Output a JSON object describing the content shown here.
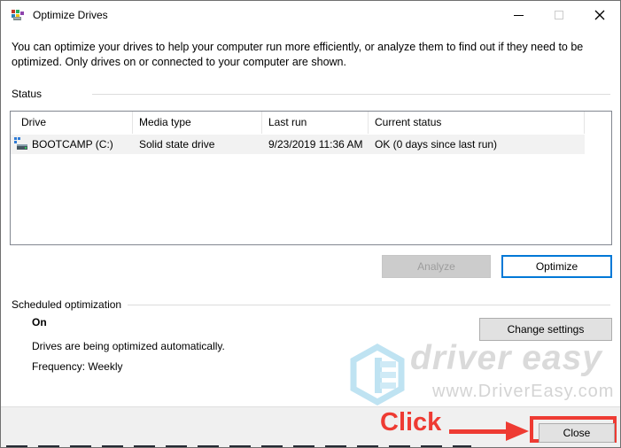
{
  "window": {
    "title": "Optimize Drives"
  },
  "description": "You can optimize your drives to help your computer run more efficiently, or analyze them to find out if they need to be optimized. Only drives on or connected to your computer are shown.",
  "status_section": {
    "label": "Status",
    "table": {
      "columns": [
        "Drive",
        "Media type",
        "Last run",
        "Current status"
      ],
      "row": {
        "drive": "BOOTCAMP (C:)",
        "media_type": "Solid state drive",
        "last_run": "9/23/2019 11:36 AM",
        "current_status": "OK (0 days since last run)"
      }
    },
    "analyze_label": "Analyze",
    "optimize_label": "Optimize"
  },
  "scheduled_section": {
    "label": "Scheduled optimization",
    "state": "On",
    "detail": "Drives are being optimized automatically.",
    "frequency": "Frequency: Weekly",
    "change_settings_label": "Change settings"
  },
  "watermark": {
    "brand": "driver easy",
    "url": "www.DriverEasy.com"
  },
  "annotation": {
    "click_label": "Click"
  },
  "footer": {
    "close_label": "Close"
  },
  "colors": {
    "accent_blue": "#0078d7",
    "annotation_red": "#ee3b33",
    "footer_bg": "#f0f0f0",
    "row_highlight": "#f2f2f2"
  }
}
